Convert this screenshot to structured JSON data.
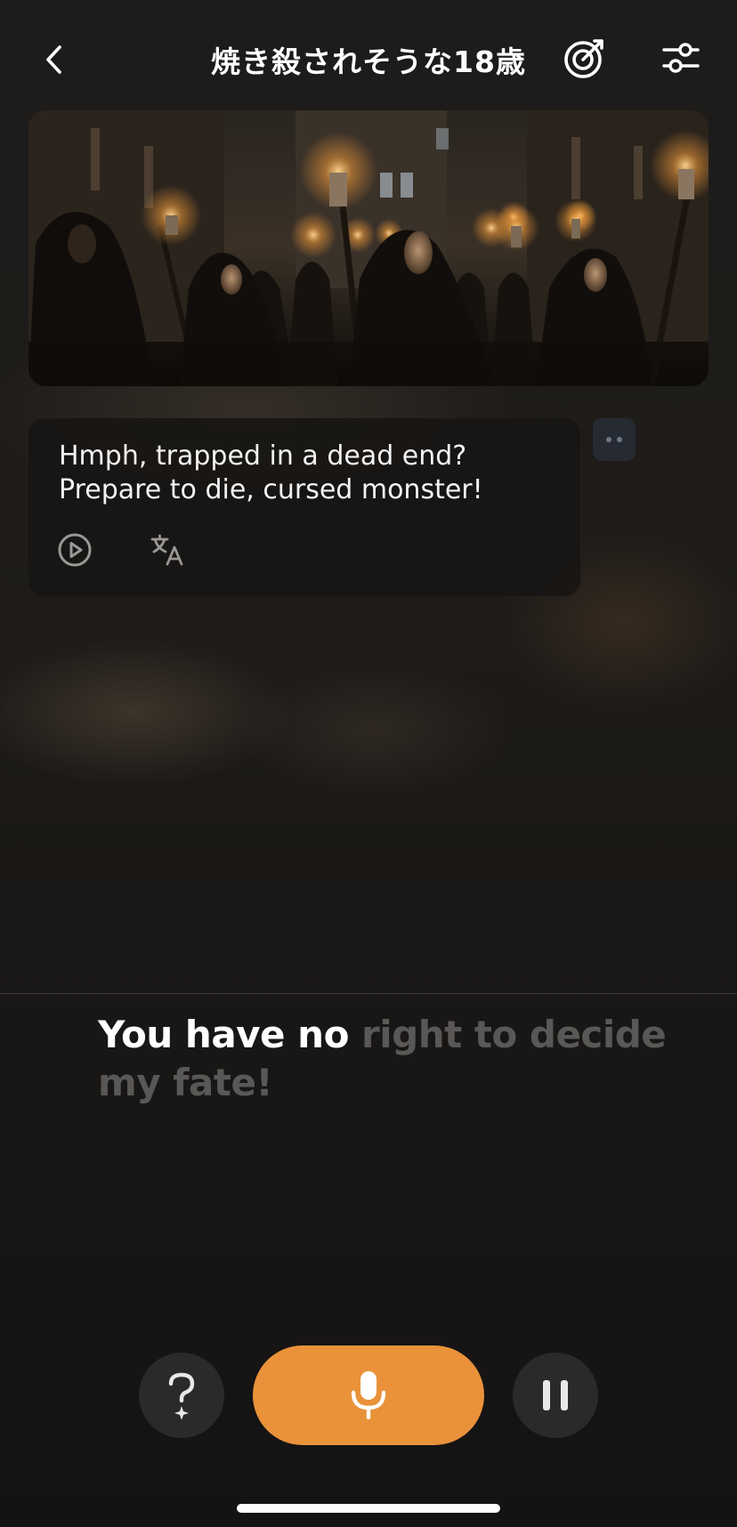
{
  "header": {
    "title": "焼き殺されそうな18歳",
    "back_icon": "chevron-left-icon",
    "goal_icon": "target-check-icon",
    "settings_icon": "sliders-icon"
  },
  "scene": {
    "image": "hooded-torch-procession-illustration"
  },
  "message": {
    "line1": "Hmph, trapped in a dead end?",
    "line2": "Prepare to die, cursed monster!",
    "play_icon": "play-circle-icon",
    "translate_icon": "translate-icon"
  },
  "transcript": {
    "spoken": "You have no ",
    "pending": "right to decide my fate!"
  },
  "controls": {
    "hint_icon": "question-sparkle-icon",
    "mic_icon": "microphone-icon",
    "pause_icon": "pause-icon"
  },
  "colors": {
    "accent": "#e9923a",
    "background": "#151412",
    "bubble": "#181614",
    "pending_text": "#5a5856"
  }
}
